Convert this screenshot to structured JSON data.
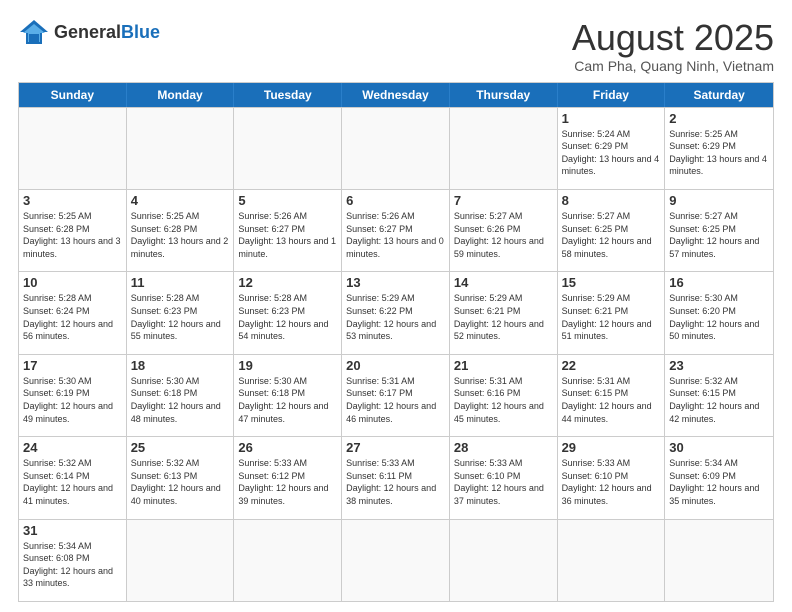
{
  "header": {
    "logo_general": "General",
    "logo_blue": "Blue",
    "month_title": "August 2025",
    "subtitle": "Cam Pha, Quang Ninh, Vietnam"
  },
  "weekdays": [
    "Sunday",
    "Monday",
    "Tuesday",
    "Wednesday",
    "Thursday",
    "Friday",
    "Saturday"
  ],
  "weeks": [
    [
      {
        "day": "",
        "info": ""
      },
      {
        "day": "",
        "info": ""
      },
      {
        "day": "",
        "info": ""
      },
      {
        "day": "",
        "info": ""
      },
      {
        "day": "",
        "info": ""
      },
      {
        "day": "1",
        "info": "Sunrise: 5:24 AM\nSunset: 6:29 PM\nDaylight: 13 hours and 4 minutes."
      },
      {
        "day": "2",
        "info": "Sunrise: 5:25 AM\nSunset: 6:29 PM\nDaylight: 13 hours and 4 minutes."
      }
    ],
    [
      {
        "day": "3",
        "info": "Sunrise: 5:25 AM\nSunset: 6:28 PM\nDaylight: 13 hours and 3 minutes."
      },
      {
        "day": "4",
        "info": "Sunrise: 5:25 AM\nSunset: 6:28 PM\nDaylight: 13 hours and 2 minutes."
      },
      {
        "day": "5",
        "info": "Sunrise: 5:26 AM\nSunset: 6:27 PM\nDaylight: 13 hours and 1 minute."
      },
      {
        "day": "6",
        "info": "Sunrise: 5:26 AM\nSunset: 6:27 PM\nDaylight: 13 hours and 0 minutes."
      },
      {
        "day": "7",
        "info": "Sunrise: 5:27 AM\nSunset: 6:26 PM\nDaylight: 12 hours and 59 minutes."
      },
      {
        "day": "8",
        "info": "Sunrise: 5:27 AM\nSunset: 6:25 PM\nDaylight: 12 hours and 58 minutes."
      },
      {
        "day": "9",
        "info": "Sunrise: 5:27 AM\nSunset: 6:25 PM\nDaylight: 12 hours and 57 minutes."
      }
    ],
    [
      {
        "day": "10",
        "info": "Sunrise: 5:28 AM\nSunset: 6:24 PM\nDaylight: 12 hours and 56 minutes."
      },
      {
        "day": "11",
        "info": "Sunrise: 5:28 AM\nSunset: 6:23 PM\nDaylight: 12 hours and 55 minutes."
      },
      {
        "day": "12",
        "info": "Sunrise: 5:28 AM\nSunset: 6:23 PM\nDaylight: 12 hours and 54 minutes."
      },
      {
        "day": "13",
        "info": "Sunrise: 5:29 AM\nSunset: 6:22 PM\nDaylight: 12 hours and 53 minutes."
      },
      {
        "day": "14",
        "info": "Sunrise: 5:29 AM\nSunset: 6:21 PM\nDaylight: 12 hours and 52 minutes."
      },
      {
        "day": "15",
        "info": "Sunrise: 5:29 AM\nSunset: 6:21 PM\nDaylight: 12 hours and 51 minutes."
      },
      {
        "day": "16",
        "info": "Sunrise: 5:30 AM\nSunset: 6:20 PM\nDaylight: 12 hours and 50 minutes."
      }
    ],
    [
      {
        "day": "17",
        "info": "Sunrise: 5:30 AM\nSunset: 6:19 PM\nDaylight: 12 hours and 49 minutes."
      },
      {
        "day": "18",
        "info": "Sunrise: 5:30 AM\nSunset: 6:18 PM\nDaylight: 12 hours and 48 minutes."
      },
      {
        "day": "19",
        "info": "Sunrise: 5:30 AM\nSunset: 6:18 PM\nDaylight: 12 hours and 47 minutes."
      },
      {
        "day": "20",
        "info": "Sunrise: 5:31 AM\nSunset: 6:17 PM\nDaylight: 12 hours and 46 minutes."
      },
      {
        "day": "21",
        "info": "Sunrise: 5:31 AM\nSunset: 6:16 PM\nDaylight: 12 hours and 45 minutes."
      },
      {
        "day": "22",
        "info": "Sunrise: 5:31 AM\nSunset: 6:15 PM\nDaylight: 12 hours and 44 minutes."
      },
      {
        "day": "23",
        "info": "Sunrise: 5:32 AM\nSunset: 6:15 PM\nDaylight: 12 hours and 42 minutes."
      }
    ],
    [
      {
        "day": "24",
        "info": "Sunrise: 5:32 AM\nSunset: 6:14 PM\nDaylight: 12 hours and 41 minutes."
      },
      {
        "day": "25",
        "info": "Sunrise: 5:32 AM\nSunset: 6:13 PM\nDaylight: 12 hours and 40 minutes."
      },
      {
        "day": "26",
        "info": "Sunrise: 5:33 AM\nSunset: 6:12 PM\nDaylight: 12 hours and 39 minutes."
      },
      {
        "day": "27",
        "info": "Sunrise: 5:33 AM\nSunset: 6:11 PM\nDaylight: 12 hours and 38 minutes."
      },
      {
        "day": "28",
        "info": "Sunrise: 5:33 AM\nSunset: 6:10 PM\nDaylight: 12 hours and 37 minutes."
      },
      {
        "day": "29",
        "info": "Sunrise: 5:33 AM\nSunset: 6:10 PM\nDaylight: 12 hours and 36 minutes."
      },
      {
        "day": "30",
        "info": "Sunrise: 5:34 AM\nSunset: 6:09 PM\nDaylight: 12 hours and 35 minutes."
      }
    ],
    [
      {
        "day": "31",
        "info": "Sunrise: 5:34 AM\nSunset: 6:08 PM\nDaylight: 12 hours and 33 minutes."
      },
      {
        "day": "",
        "info": ""
      },
      {
        "day": "",
        "info": ""
      },
      {
        "day": "",
        "info": ""
      },
      {
        "day": "",
        "info": ""
      },
      {
        "day": "",
        "info": ""
      },
      {
        "day": "",
        "info": ""
      }
    ]
  ]
}
